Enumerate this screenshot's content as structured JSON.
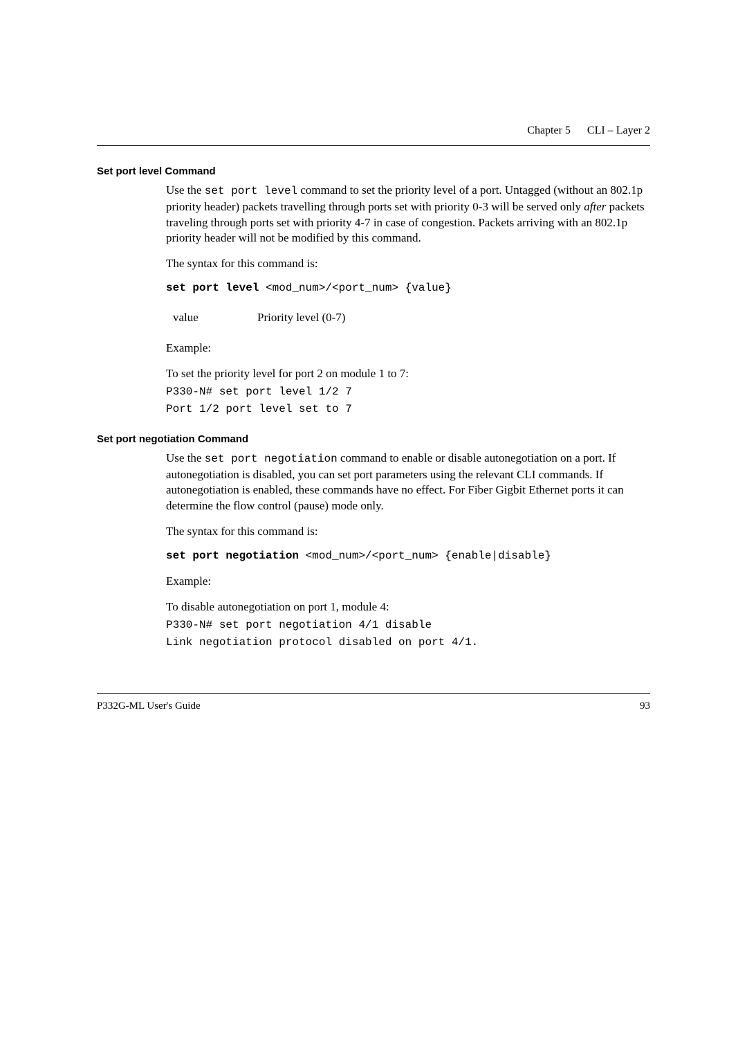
{
  "header": {
    "chapter": "Chapter 5",
    "title": "CLI – Layer 2"
  },
  "section1": {
    "heading": "Set port level Command",
    "para1_prefix": "Use the ",
    "para1_cmd": "set port level",
    "para1_mid": " command to set the priority level of a port. Untagged (without an 802.1p priority header) packets travelling through ports set with priority 0-3 will be served only ",
    "para1_italic": "after",
    "para1_suffix": " packets traveling through ports set with priority 4-7 in case of congestion. Packets arriving with an 802.1p priority header will not be modified by this command.",
    "syntax_label": "The syntax for this command is:",
    "syntax_bold": "set port level",
    "syntax_args": " <mod_num>/<port_num> {value}",
    "param_name": "value",
    "param_desc": "Priority level (0-7)",
    "example_label": "Example:",
    "example_desc": "To set the priority level for port 2 on module 1 to 7:",
    "example_code": "P330-N# set port level 1/2 7\nPort 1/2 port level set to 7"
  },
  "section2": {
    "heading": "Set port negotiation Command",
    "para1_prefix": "Use the ",
    "para1_cmd": "set port negotiation",
    "para1_suffix": " command to enable or disable autonegotiation on a port. If autonegotiation is disabled, you can set port parameters using the relevant CLI commands. If autonegotiation is enabled, these commands have no effect. For Fiber Gigbit Ethernet ports it can determine the flow control (pause) mode only.",
    "syntax_label": "The syntax for this command is:",
    "syntax_bold": "set port negotiation",
    "syntax_args": " <mod_num>/<port_num> {enable|disable}",
    "example_label": "Example:",
    "example_desc": "To disable autonegotiation on port 1, module 4:",
    "example_code": "P330-N# set port negotiation 4/1 disable\nLink negotiation protocol disabled on port 4/1."
  },
  "footer": {
    "left": "P332G-ML User's Guide",
    "right": "93"
  }
}
